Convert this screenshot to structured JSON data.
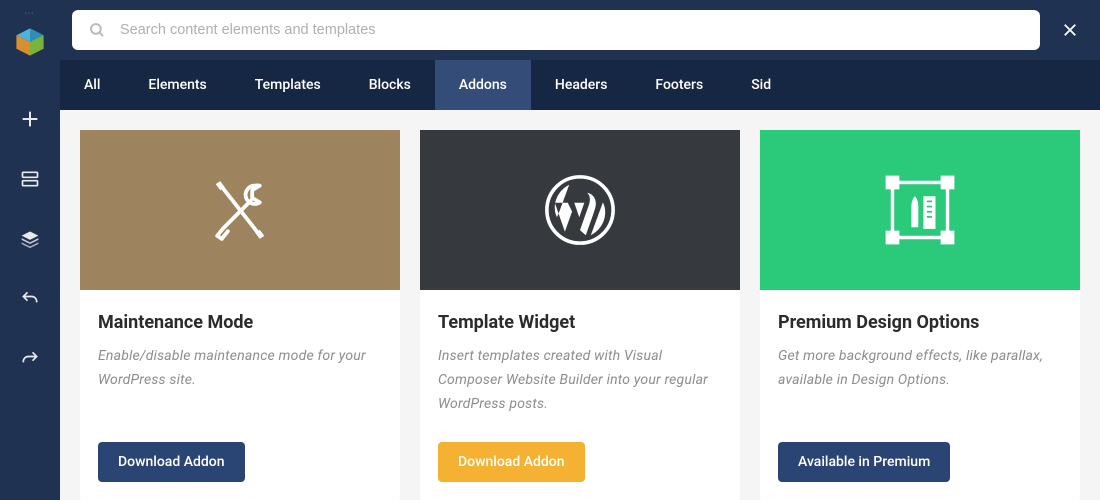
{
  "search": {
    "placeholder": "Search content elements and templates",
    "value": ""
  },
  "tabs": [
    {
      "label": "All",
      "active": false
    },
    {
      "label": "Elements",
      "active": false
    },
    {
      "label": "Templates",
      "active": false
    },
    {
      "label": "Blocks",
      "active": false
    },
    {
      "label": "Addons",
      "active": true
    },
    {
      "label": "Headers",
      "active": false
    },
    {
      "label": "Footers",
      "active": false
    },
    {
      "label": "Sid",
      "active": false
    }
  ],
  "cards": [
    {
      "title": "Maintenance Mode",
      "desc": "Enable/disable maintenance mode for your WordPress site.",
      "button": "Download Addon",
      "button_style": "navy",
      "hero_color": "#9d845e",
      "icon": "tools"
    },
    {
      "title": "Template Widget",
      "desc": "Insert templates created with Visual Composer Website Builder into your regular WordPress posts.",
      "button": "Download Addon",
      "button_style": "orange",
      "hero_color": "#363a3f",
      "icon": "wordpress"
    },
    {
      "title": "Premium Design Options",
      "desc": "Get more background effects, like parallax, available in Design Options.",
      "button": "Available in Premium",
      "button_style": "navy",
      "hero_color": "#2bc97a",
      "icon": "design"
    }
  ],
  "rail_icons": [
    "plus",
    "layout",
    "layers",
    "undo",
    "redo"
  ],
  "colors": {
    "navy_dark": "#162744",
    "navy": "#203251",
    "tab_active": "#344d78",
    "orange": "#f5b132",
    "green": "#2bc97a",
    "brown": "#9d845e",
    "charcoal": "#363a3f"
  }
}
